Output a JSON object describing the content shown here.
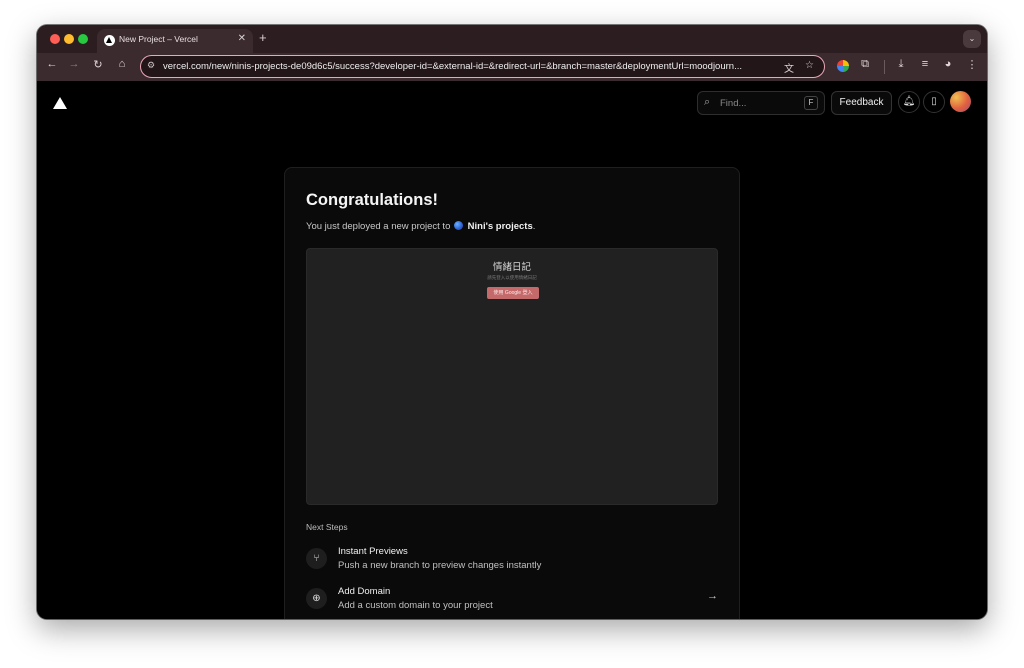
{
  "browser": {
    "tab_title": "New Project – Vercel",
    "tab_close": "✕",
    "new_tab": "+",
    "url": "vercel.com/new/ninis-projects-de09d6c5/success?developer-id=&external-id=&redirect-url=&branch=master&deploymentUrl=moodjourn...",
    "icons": [
      "back-icon",
      "forward-icon",
      "reload-icon",
      "home-icon",
      "site-info-icon",
      "translate-icon",
      "star-icon",
      "extensions-icon",
      "download-icon",
      "media-icon",
      "profile-icon",
      "menu-icon"
    ]
  },
  "header": {
    "find_placeholder": "Find...",
    "find_shortcut": "F",
    "feedback_label": "Feedback"
  },
  "card": {
    "title": "Congratulations!",
    "subtitle_prefix": "You just deployed a new project to",
    "team_name": "Nini's projects",
    "subtitle_suffix": ".",
    "preview": {
      "app_title": "情緒日記",
      "app_subtitle": "請先登入以使用情緒日記",
      "login_button": "使用 Google 登入"
    },
    "next_steps_label": "Next Steps",
    "steps": [
      {
        "title": "Instant Previews",
        "desc": "Push a new branch to preview changes instantly",
        "icon": "git-branch-icon"
      },
      {
        "title": "Add Domain",
        "desc": "Add a custom domain to your project",
        "icon": "globe-icon"
      }
    ]
  },
  "colors": {
    "page_bg": "#000000",
    "card_bg": "#0a0a0a",
    "omnibox_border": "#e8a8b8",
    "preview_button": "#c56a6a"
  }
}
